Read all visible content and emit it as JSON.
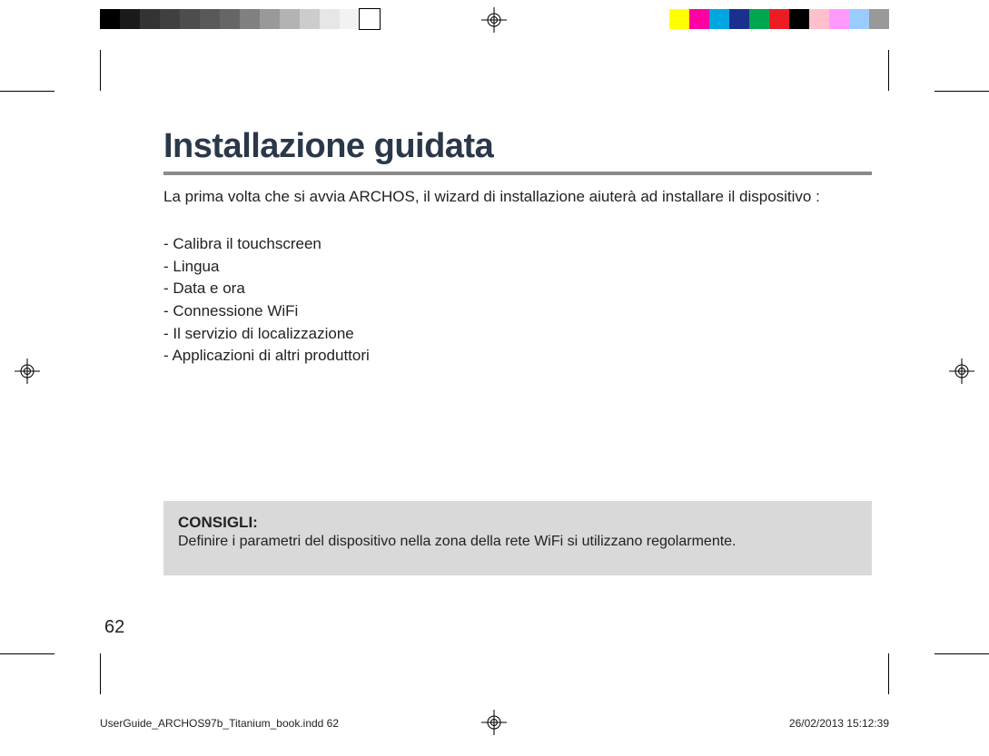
{
  "title": "Installazione guidata",
  "intro": "La prima volta che si avvia ARCHOS, il wizard di installazione aiuterà ad installare il dispositivo :",
  "steps": [
    "Calibra il touchscreen",
    "Lingua",
    "Data e ora",
    "Connessione WiFi",
    "Il servizio di localizzazione",
    "Applicazioni di altri produttori"
  ],
  "tip": {
    "label": "CONSIGLI:",
    "text": "Definire i parametri del dispositivo nella zona della rete WiFi si utilizzano regolarmente."
  },
  "page_number": "62",
  "footer": {
    "file": "UserGuide_ARCHOS97b_Titanium_book.indd   62",
    "timestamp": "26/02/2013   15:12:39"
  },
  "colorbar_left": [
    "#000000",
    "#1a1a1a",
    "#333333",
    "#404040",
    "#4d4d4d",
    "#595959",
    "#666666",
    "#808080",
    "#999999",
    "#b3b3b3",
    "#cccccc",
    "#e6e6e6",
    "#f2f2f2",
    "#ffffff"
  ],
  "colorbar_right": [
    "#ffff00",
    "#ff00a2",
    "#00a6e0",
    "#1b2f8f",
    "#00a650",
    "#ed1c24",
    "#000000",
    "#ffc0cb",
    "#ff99ff",
    "#99ccff",
    "#999999"
  ]
}
